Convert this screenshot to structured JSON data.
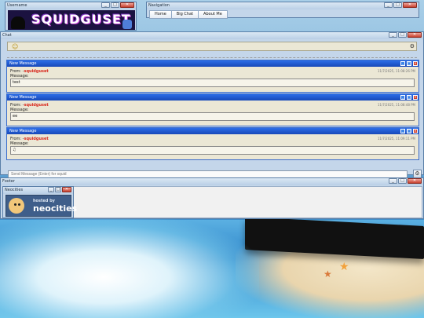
{
  "windows": {
    "username": {
      "title": "Username",
      "logo_text": "SQUIDGUSET"
    },
    "navigation": {
      "title": "Navigation",
      "buttons": [
        "Home",
        "Big Chat",
        "About Me"
      ]
    },
    "chat": {
      "title": "Chat",
      "messages": [
        {
          "title": "New Message",
          "from_label": "From: -",
          "sender": "squidguset",
          "timestamp": "11/7/2025, 11:08:26 PM",
          "body_label": "Message:",
          "body": "test"
        },
        {
          "title": "New Message",
          "from_label": "From: -",
          "sender": "squidguset",
          "timestamp": "11/7/2025, 11:08:48 PM",
          "body_label": "Message:",
          "body": "ee"
        },
        {
          "title": "New Message",
          "from_label": "From: -",
          "sender": "squidguset",
          "timestamp": "11/7/2025, 11:09:11 PM",
          "body_label": "Message:",
          "body": "♫"
        }
      ],
      "input_placeholder": "Send Message (Enter) for squid",
      "emoji_icon": "smiley-icon",
      "settings_icon": "gear-icon",
      "send_icon": "gear-icon"
    },
    "footer": {
      "title": "Footer"
    },
    "neocities": {
      "title": "Neocities",
      "hosted_by": "hosted by",
      "brand": "neocities"
    }
  },
  "window_controls": {
    "minimize": "_",
    "maximize": "□",
    "close": "✕"
  },
  "colors": {
    "title_blue": "#1849b8",
    "sender_red": "#d8271c",
    "window_bg": "#c4d6ea"
  }
}
